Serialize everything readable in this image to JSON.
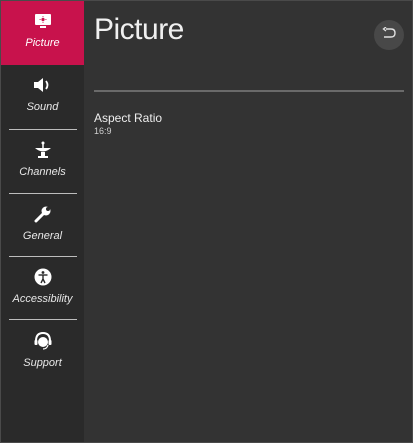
{
  "sidebar": {
    "items": [
      {
        "label": "Picture",
        "icon": "picture-icon",
        "active": true
      },
      {
        "label": "Sound",
        "icon": "speaker-icon"
      },
      {
        "label": "Channels",
        "icon": "satellite-dish-icon"
      },
      {
        "label": "General",
        "icon": "wrench-icon"
      },
      {
        "label": "Accessibility",
        "icon": "accessibility-icon"
      },
      {
        "label": "Support",
        "icon": "headset-icon"
      }
    ]
  },
  "main": {
    "title": "Picture",
    "back_icon": "back-arrow-icon",
    "settings": [
      {
        "label": "Aspect Ratio",
        "value": "16:9"
      }
    ]
  },
  "colors": {
    "accent": "#c8124c",
    "sidebar_bg": "#2a2a2a",
    "main_bg": "#333333"
  }
}
